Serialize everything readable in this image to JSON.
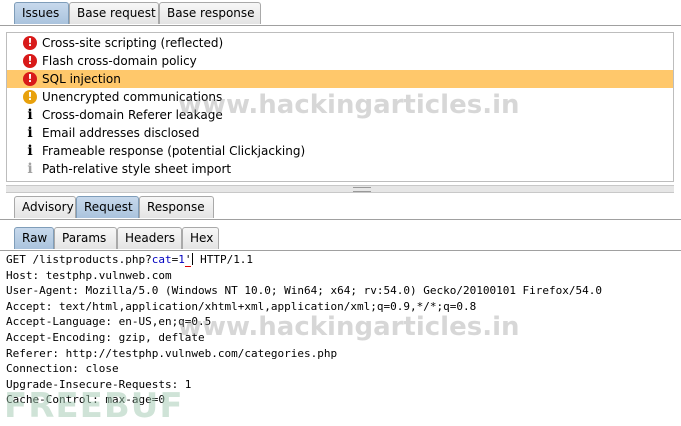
{
  "top_tabs": [
    {
      "label": "Issues",
      "selected": true
    },
    {
      "label": "Base request",
      "selected": false
    },
    {
      "label": "Base response",
      "selected": false
    }
  ],
  "issues": [
    {
      "label": "Cross-site scripting (reflected)",
      "severity": "high",
      "icon": "exclamation-red-icon"
    },
    {
      "label": "Flash cross-domain policy",
      "severity": "high",
      "icon": "exclamation-red-icon"
    },
    {
      "label": "SQL injection",
      "severity": "high",
      "icon": "exclamation-red-icon",
      "selected": true
    },
    {
      "label": "Unencrypted communications",
      "severity": "low",
      "icon": "exclamation-orange-icon"
    },
    {
      "label": "Cross-domain Referer leakage",
      "severity": "info",
      "icon": "info-icon"
    },
    {
      "label": "Email addresses disclosed",
      "severity": "info",
      "icon": "info-icon"
    },
    {
      "label": "Frameable response (potential Clickjacking)",
      "severity": "info",
      "icon": "info-icon"
    },
    {
      "label": "Path-relative style sheet import",
      "severity": "info-tentative",
      "icon": "info-light-icon"
    }
  ],
  "detail_tabs": [
    {
      "label": "Advisory",
      "selected": false
    },
    {
      "label": "Request",
      "selected": true
    },
    {
      "label": "Response",
      "selected": false
    }
  ],
  "view_tabs": [
    {
      "label": "Raw",
      "selected": true
    },
    {
      "label": "Params",
      "selected": false
    },
    {
      "label": "Headers",
      "selected": false
    },
    {
      "label": "Hex",
      "selected": false
    }
  ],
  "request": {
    "line1_prefix": "GET /listproducts.php?",
    "line1_param": "cat",
    "line1_eq": "=",
    "line1_value": "1",
    "line1_quote": "'",
    "line1_suffix": " HTTP/1.1",
    "lines": [
      "Host: testphp.vulnweb.com",
      "User-Agent: Mozilla/5.0 (Windows NT 10.0; Win64; x64; rv:54.0) Gecko/20100101 Firefox/54.0",
      "Accept: text/html,application/xhtml+xml,application/xml;q=0.9,*/*;q=0.8",
      "Accept-Language: en-US,en;q=0.5",
      "Accept-Encoding: gzip, deflate",
      "Referer: http://testphp.vulnweb.com/categories.php",
      "Connection: close",
      "Upgrade-Insecure-Requests: 1",
      "Cache-Control: max-age=0"
    ]
  },
  "watermarks": {
    "site": "www.hackingarticles.in",
    "logo": "FREEBUF"
  },
  "colors": {
    "selected_row": "#ffc86b",
    "severity_high": "#d81a1a",
    "severity_low": "#e8a10c",
    "param_highlight": "#0000c0"
  }
}
